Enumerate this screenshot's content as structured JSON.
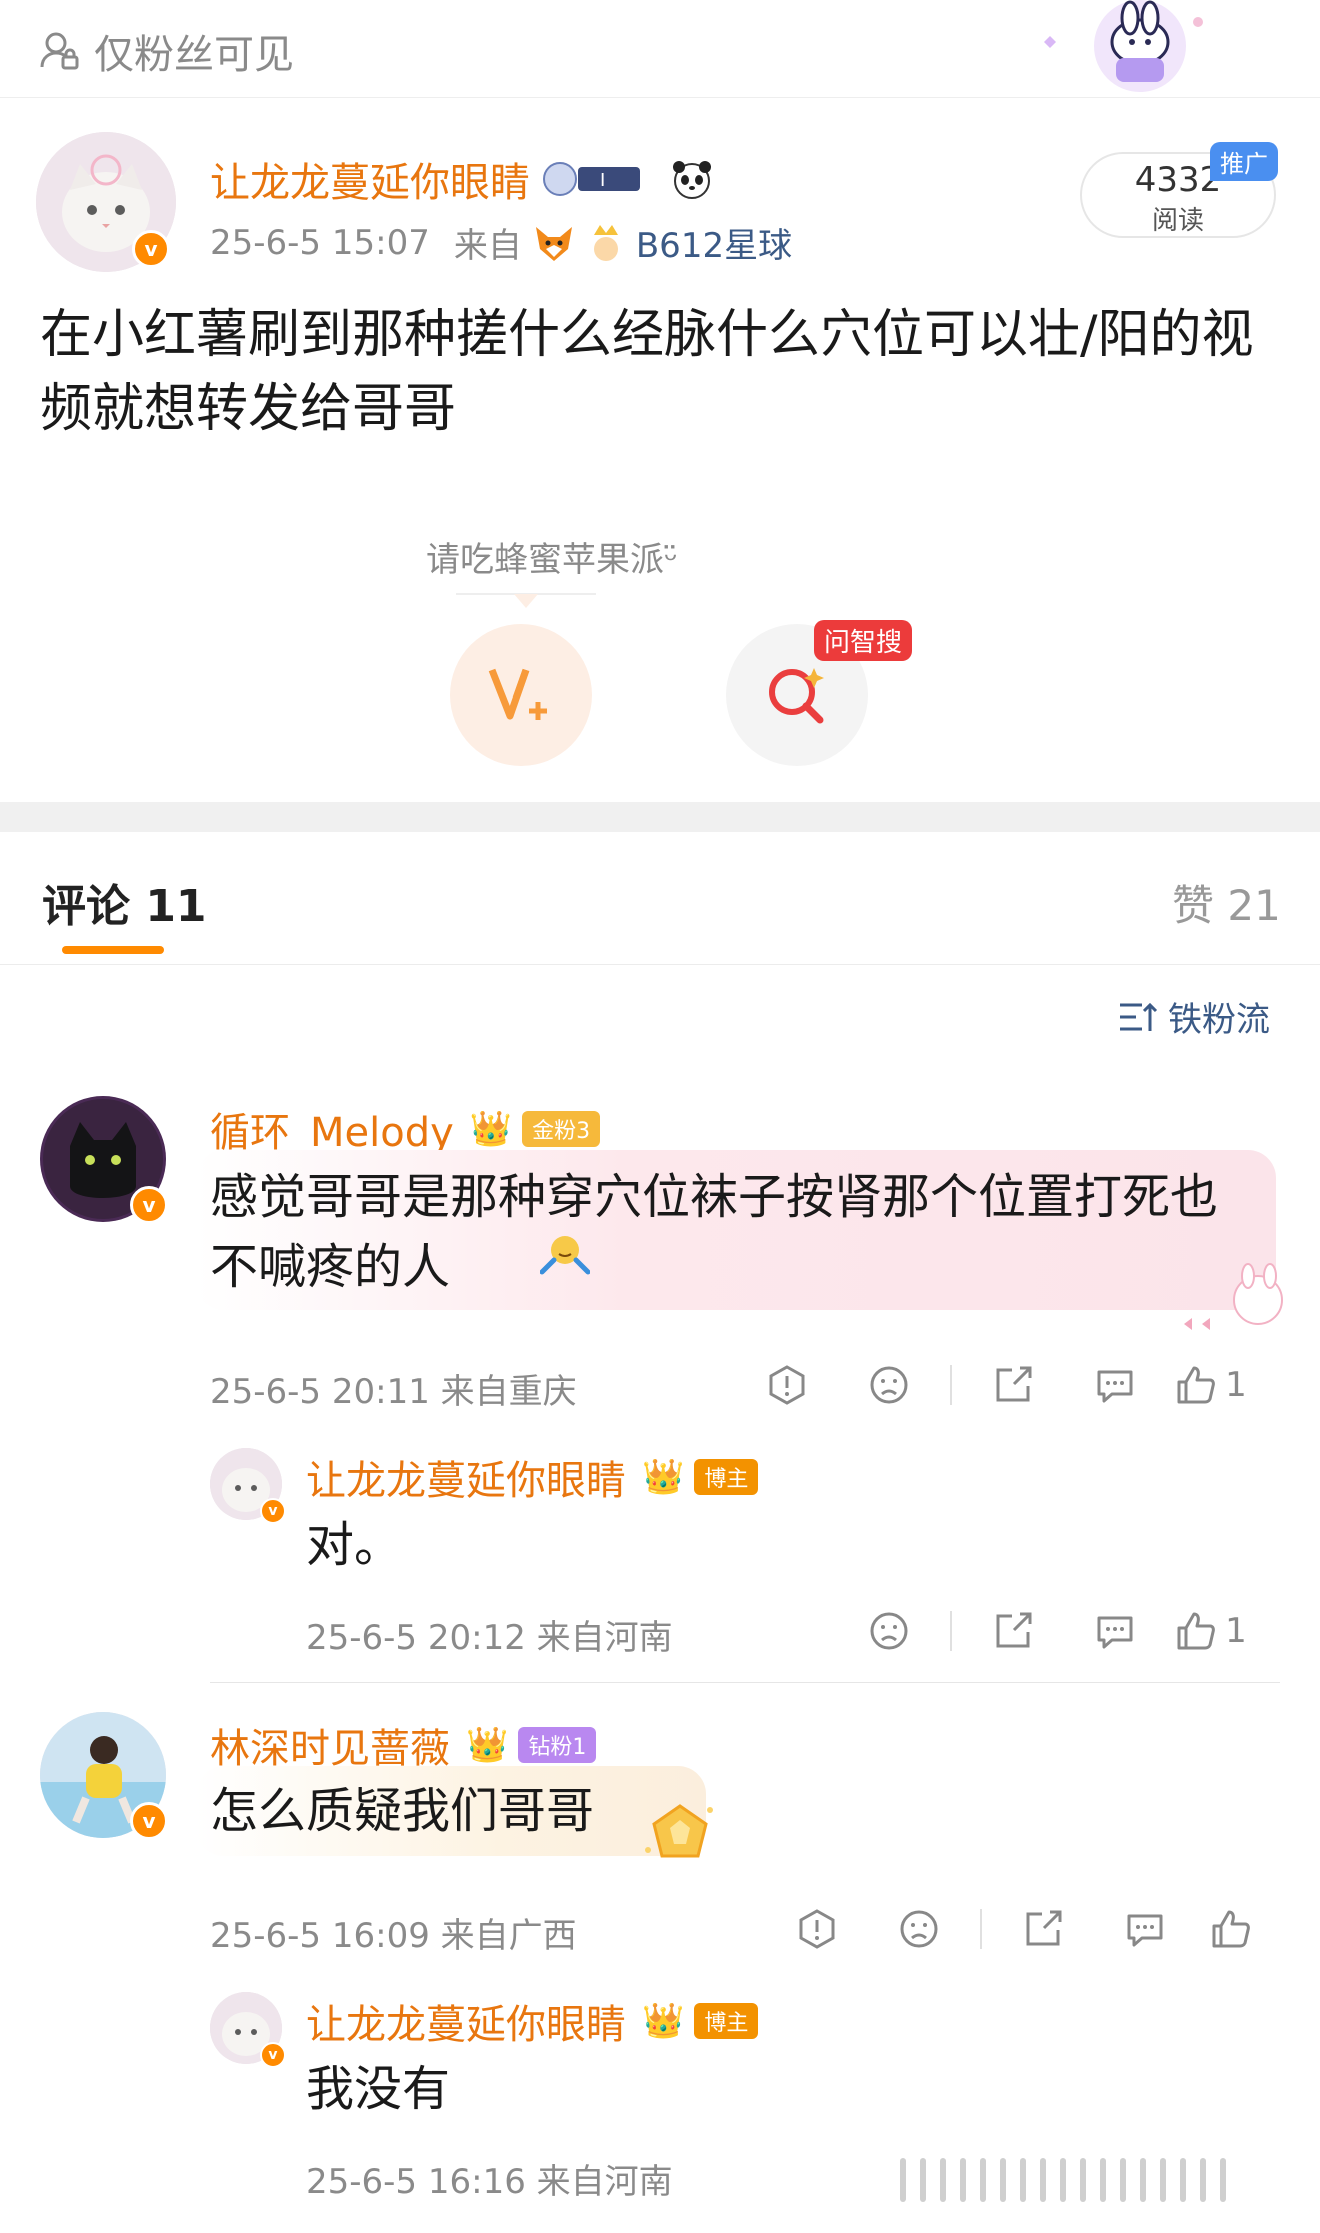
{
  "header": {
    "visibility_label": "仅粉丝可见",
    "icon": "lock-people-icon"
  },
  "post": {
    "author": "让龙龙蔓延你眼睛",
    "timestamp": "25-6-5 15:07",
    "source_prefix": "来自",
    "source_name": "B612星球",
    "read_count": "4332",
    "read_label": "阅读",
    "promo_tag": "推广",
    "body": "在小红薯刷到那种搓什么经脉什么穴位可以壮/阳的视频就想转发给哥哥",
    "gift_prompt": "请吃蜂蜜苹果派ᵕ̈",
    "zhi_tag": "问智搜"
  },
  "tabs": {
    "comments_label": "评论 11",
    "likes_label": "赞 21",
    "sort_label": "铁粉流"
  },
  "comments": [
    {
      "user": "循环_Melody",
      "fan_tag": "金粉3",
      "text": "感觉哥哥是那种穿穴位袜子按肾那个位置打死也不喊疼的人",
      "meta": "25-6-5 20:11 来自重庆",
      "likes": "1",
      "reply": {
        "user": "让龙龙蔓延你眼睛",
        "tag": "博主",
        "text": "对。",
        "meta": "25-6-5 20:12 来自河南",
        "likes": "1"
      }
    },
    {
      "user": "林深时见蔷薇",
      "fan_tag": "钻粉1",
      "text": "怎么质疑我们哥哥",
      "meta": "25-6-5 16:09 来自广西",
      "likes": "",
      "reply": {
        "user": "让龙龙蔓延你眼睛",
        "tag": "博主",
        "text": "我没有",
        "meta": "25-6-5 16:16 来自河南"
      }
    }
  ],
  "colors": {
    "accent": "#ff8a00",
    "username": "#e8760f",
    "meta": "#8a8a8a",
    "link": "#3b5a86"
  }
}
